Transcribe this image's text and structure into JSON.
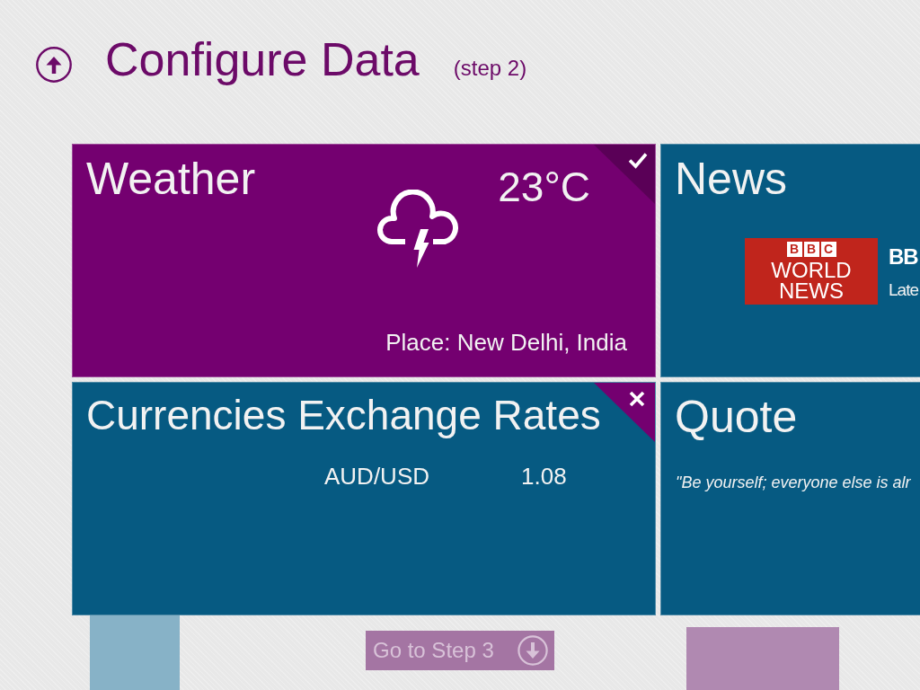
{
  "header": {
    "title": "Configure Data",
    "step": "(step 2)"
  },
  "tiles": [
    {
      "kind": "weather",
      "title": "Weather",
      "checked": true,
      "temperature": "23°C",
      "place": "Place: New Delhi, India"
    },
    {
      "kind": "news",
      "title": "News",
      "logo": {
        "letters": [
          "B",
          "B",
          "C"
        ],
        "lines": [
          "WORLD",
          "NEWS"
        ]
      },
      "source": "BB",
      "summary": "Late"
    },
    {
      "kind": "currency",
      "title": "Currencies Exchange Rates",
      "removable": true,
      "rates": [
        {
          "pair": "AUD/USD",
          "value": "1.08"
        }
      ]
    },
    {
      "kind": "quote",
      "title": "Quote",
      "text": "\"Be yourself; everyone else is alr"
    }
  ],
  "next_button": {
    "label": "Go to Step 3",
    "disabled": true
  }
}
